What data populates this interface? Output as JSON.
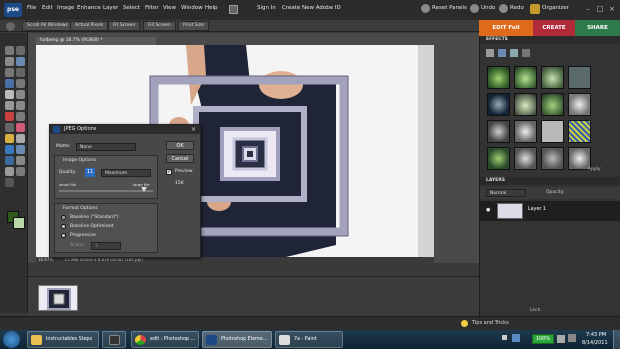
{
  "app": {
    "logo": "pse"
  },
  "menu": [
    "File",
    "Edit",
    "Image",
    "Enhance",
    "Layer",
    "Select",
    "Filter",
    "View",
    "Window",
    "Help"
  ],
  "header_links": {
    "sign_in": "Sign In",
    "create_id": "Create New Adobe ID",
    "reset_panels": "Reset Panels",
    "undo": "Undo",
    "redo": "Redo",
    "organizer": "Organizer"
  },
  "options_bar": [
    "Scroll All Windows",
    "Actual Pixels",
    "Fit Screen",
    "Fill Screen",
    "Print Size"
  ],
  "mode_tabs": {
    "edit": "EDIT Full",
    "create": "CREATE",
    "share": "SHARE"
  },
  "document": {
    "tab_title": "fullbeng @ 16.7% (RGB/8) *",
    "zoom": "16.67%",
    "doc_info": "11.986 inches x 8.879 inches (180 ppi)"
  },
  "panels": {
    "effects": "EFFECTS",
    "layers": "LAYERS",
    "blend_mode": "Normal",
    "opacity_label": "Opacity:",
    "apply": "Apply",
    "layer_name": "Layer 1",
    "lock": "Lock:"
  },
  "dialog": {
    "title": "JPEG Options",
    "matte_label": "Matte:",
    "matte_value": "None",
    "image_options": "Image Options",
    "quality_label": "Quality:",
    "quality_value": "11",
    "quality_preset": "Maximum",
    "small_file": "small file",
    "large_file": "large file",
    "format_options": "Format Options",
    "formats": [
      "Baseline (\"Standard\")",
      "Baseline Optimized",
      "Progressive"
    ],
    "scans_label": "Scans:",
    "scans_value": "3",
    "ok": "OK",
    "cancel": "Cancel",
    "preview": "Preview",
    "file_size": "15K"
  },
  "tips": "Tips and Tricks",
  "taskbar": {
    "items": [
      "Instructables Steps",
      "",
      "edit : Photoshop ...",
      "Photoshop Eleme...",
      "7a - Paint"
    ],
    "battery": "100%",
    "time": "7:43 PM",
    "date": "8/14/2011"
  },
  "colors": {
    "accent_edit": "#e06a1a",
    "accent_create": "#b02a3a",
    "accent_share": "#2f7a4a",
    "foreground_color": "#2e5a1e",
    "background_color": "#b8d8a8"
  }
}
